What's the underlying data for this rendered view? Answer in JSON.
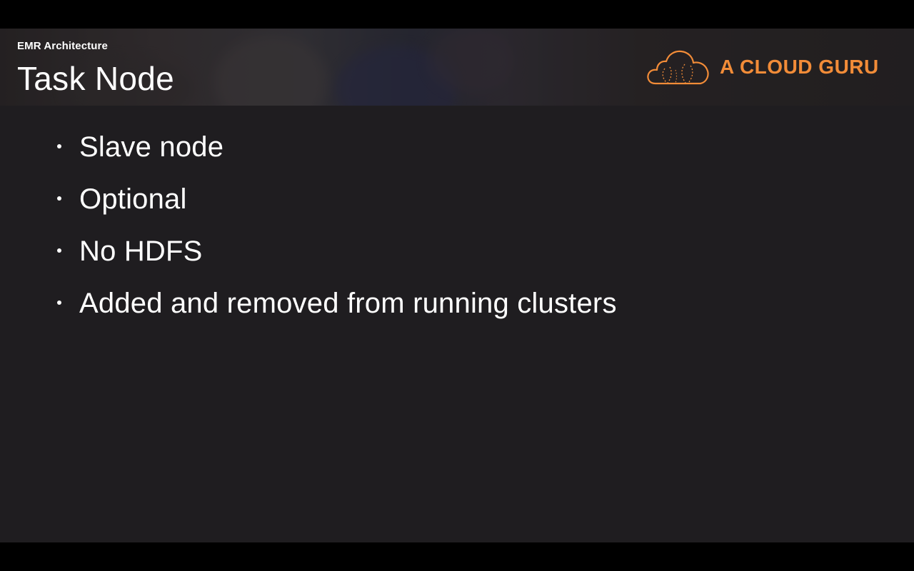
{
  "slide": {
    "section": "EMR Architecture",
    "title": "Task Node",
    "bullets": [
      "Slave node",
      "Optional",
      "No HDFS",
      "Added and removed from running clusters"
    ]
  },
  "logo": {
    "text": "A CLOUD GURU",
    "icon": "cloud-logo-icon",
    "color": "#f28c38"
  },
  "colors": {
    "background": "#1f1d20",
    "text": "#ffffff",
    "letterbox": "#000000"
  }
}
